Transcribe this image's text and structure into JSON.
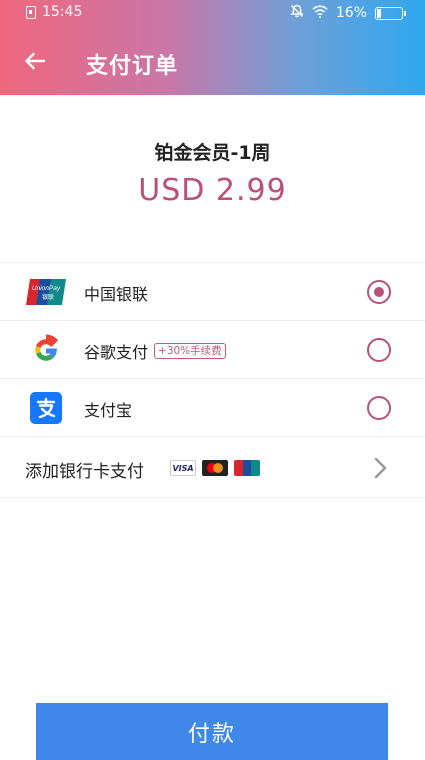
{
  "status_bar": {
    "time": "15:45",
    "battery_percent": "16%",
    "battery_level": 0.16
  },
  "app_bar": {
    "title": "支付订单"
  },
  "order": {
    "product": "铂金会员-1周",
    "price": "USD 2.99"
  },
  "payment_methods": [
    {
      "label": "中国银联",
      "icon": "unionpay-icon",
      "selected": true,
      "badge": ""
    },
    {
      "label": "谷歌支付",
      "icon": "google-icon",
      "selected": false,
      "badge": "+30%手续费"
    },
    {
      "label": "支付宝",
      "icon": "alipay-icon",
      "selected": false,
      "badge": ""
    }
  ],
  "add_card": {
    "label": "添加银行卡支付",
    "card_logos": [
      "VISA",
      "mastercard-icon",
      "unionpay-icon"
    ]
  },
  "pay_button": {
    "label": "付款"
  },
  "colors": {
    "accent": "#b8507a",
    "button": "#3f87e8",
    "header_start": "#f0677d",
    "header_end": "#2ea8f0"
  }
}
